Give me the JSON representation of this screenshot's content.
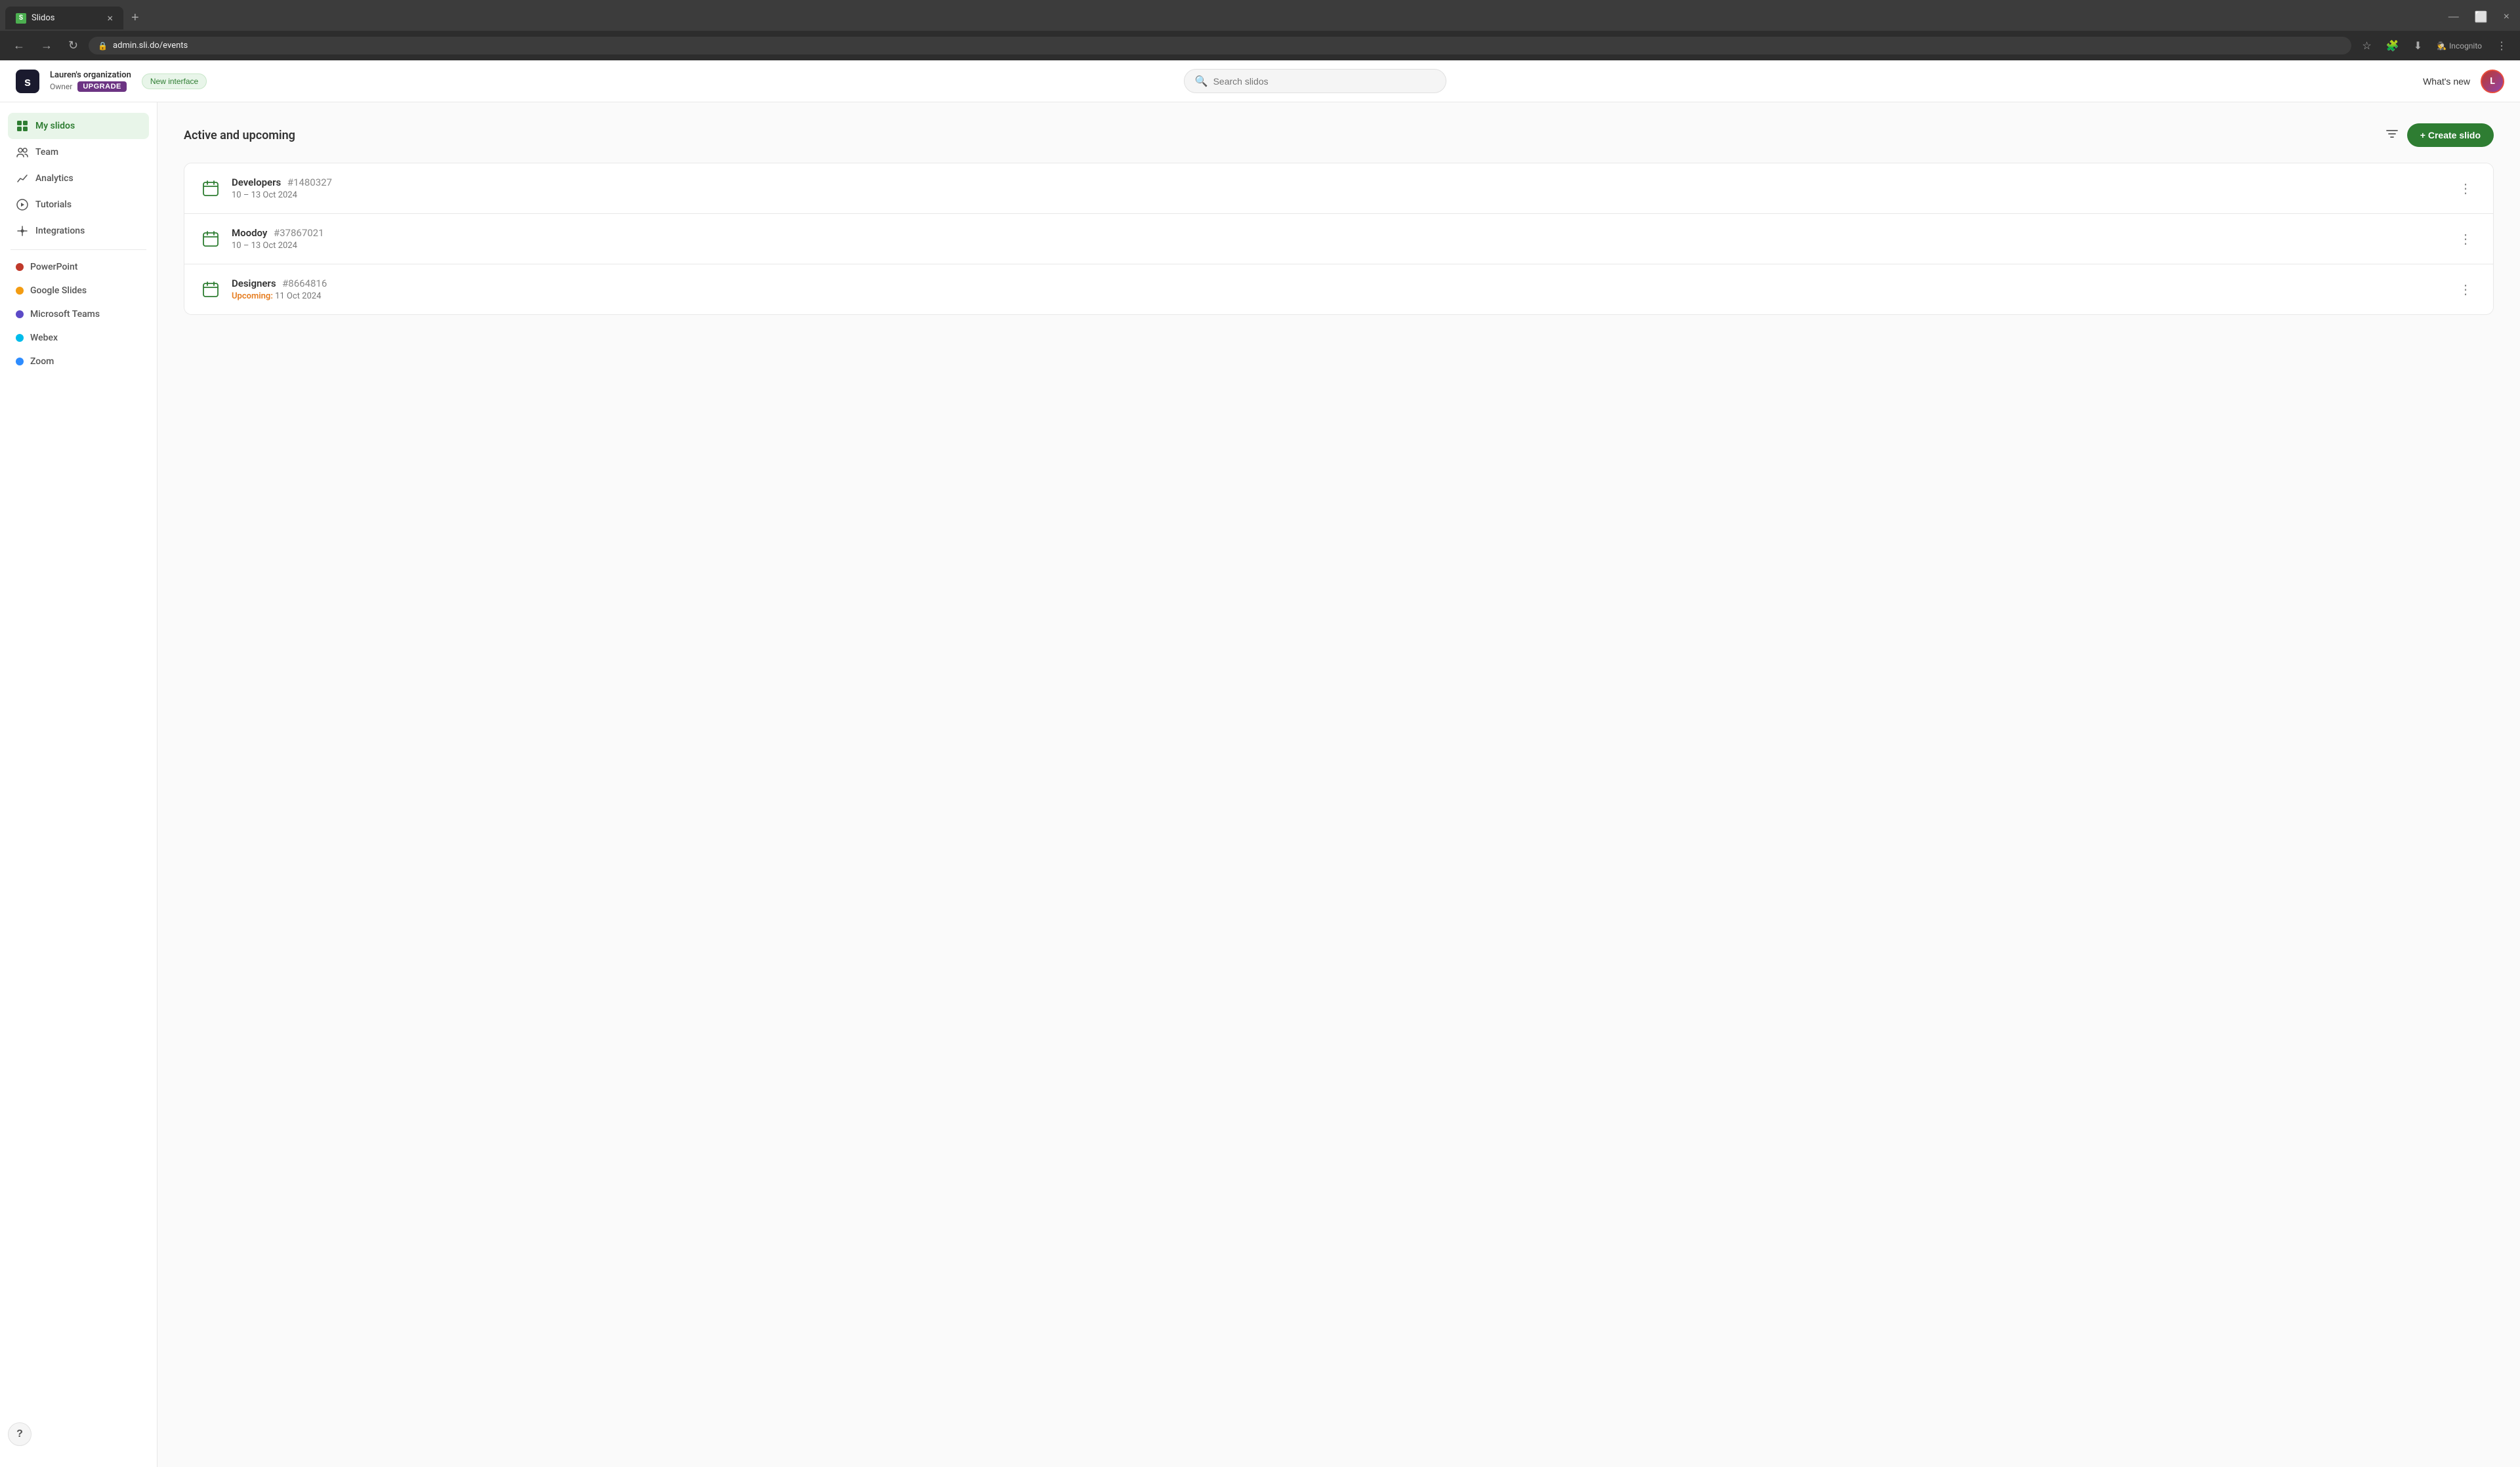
{
  "browser": {
    "tab_favicon": "S",
    "tab_title": "Slidos",
    "close_icon": "×",
    "new_tab_icon": "+",
    "back_icon": "←",
    "forward_icon": "→",
    "refresh_icon": "↻",
    "address": "admin.sli.do/events",
    "incognito_label": "Incognito",
    "maximize_icon": "⬜",
    "minimize_icon": "—",
    "close_window_icon": "×",
    "more_icon": "⋮"
  },
  "header": {
    "org_name": "Lauren's organization",
    "role": "Owner",
    "upgrade_label": "UPGRADE",
    "new_interface_label": "New interface",
    "search_placeholder": "Search slidos",
    "whats_new_label": "What's new",
    "avatar_initials": "L"
  },
  "sidebar": {
    "items": [
      {
        "id": "my-slidos",
        "label": "My slidos",
        "active": true
      },
      {
        "id": "team",
        "label": "Team",
        "active": false
      },
      {
        "id": "analytics",
        "label": "Analytics",
        "active": false
      },
      {
        "id": "tutorials",
        "label": "Tutorials",
        "active": false
      },
      {
        "id": "integrations",
        "label": "Integrations",
        "active": false
      }
    ],
    "integrations": [
      {
        "id": "powerpoint",
        "label": "PowerPoint",
        "color": "#c0392b"
      },
      {
        "id": "google-slides",
        "label": "Google Slides",
        "color": "#f39c12"
      },
      {
        "id": "microsoft-teams",
        "label": "Microsoft Teams",
        "color": "#5c4ac7"
      },
      {
        "id": "webex",
        "label": "Webex",
        "color": "#00bceb"
      },
      {
        "id": "zoom",
        "label": "Zoom",
        "color": "#2d8cff"
      }
    ],
    "help_icon": "?"
  },
  "main": {
    "section_title": "Active and upcoming",
    "create_button_label": "+ Create slido",
    "events": [
      {
        "name": "Developers",
        "id": "#1480327",
        "date": "10 – 13 Oct 2024",
        "upcoming": false
      },
      {
        "name": "Moodoy",
        "id": "#37867021",
        "date": "10 – 13 Oct 2024",
        "upcoming": false
      },
      {
        "name": "Designers",
        "id": "#8664816",
        "date": "11 Oct 2024",
        "upcoming": true,
        "upcoming_label": "Upcoming:"
      }
    ]
  }
}
